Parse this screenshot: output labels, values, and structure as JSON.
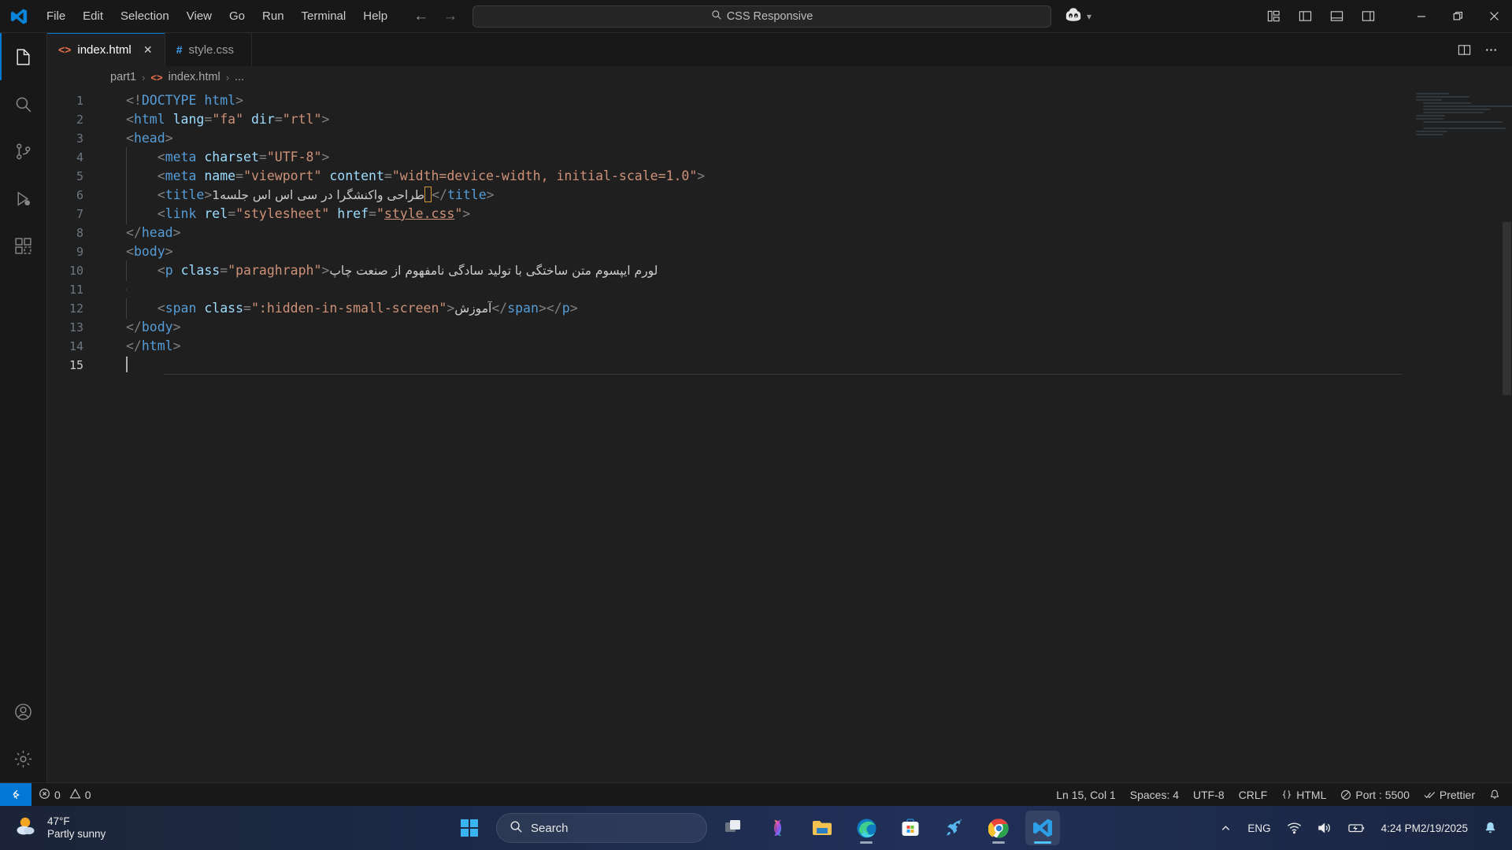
{
  "titlebar": {
    "logo_icon": "vscode-logo",
    "menus": [
      "File",
      "Edit",
      "Selection",
      "View",
      "Go",
      "Run",
      "Terminal",
      "Help"
    ],
    "back_icon": "arrow-left-icon",
    "forward_icon": "arrow-right-icon",
    "search_icon": "search-icon",
    "search_value": "CSS Responsive",
    "copilot_icon": "copilot-icon",
    "copilot_chevron_icon": "chevron-down-icon",
    "layout_buttons": [
      {
        "name": "customize-layout",
        "icon": "layout-customize-icon"
      },
      {
        "name": "toggle-primary-sidebar",
        "icon": "layout-sidebar-left-icon"
      },
      {
        "name": "toggle-panel",
        "icon": "layout-panel-icon"
      },
      {
        "name": "toggle-secondary-sidebar",
        "icon": "layout-sidebar-right-icon"
      }
    ],
    "window_buttons": [
      {
        "name": "minimize",
        "glyph": "—"
      },
      {
        "name": "maximize",
        "glyph": "❐"
      },
      {
        "name": "close",
        "glyph": "✕"
      }
    ]
  },
  "activitybar": {
    "items": [
      {
        "name": "explorer",
        "icon": "files-icon",
        "active": true
      },
      {
        "name": "search",
        "icon": "search-icon",
        "active": false
      },
      {
        "name": "source-control",
        "icon": "source-control-icon",
        "active": false
      },
      {
        "name": "run-and-debug",
        "icon": "debug-icon",
        "active": false
      },
      {
        "name": "extensions",
        "icon": "extensions-icon",
        "active": false
      }
    ],
    "bottom": [
      {
        "name": "accounts",
        "icon": "account-icon"
      },
      {
        "name": "manage",
        "icon": "gear-icon"
      }
    ]
  },
  "tabs": [
    {
      "label": "index.html",
      "icon": "html-file-icon",
      "active": true,
      "close_glyph": "✕"
    },
    {
      "label": "style.css",
      "icon": "css-file-icon",
      "active": false,
      "close_glyph": ""
    }
  ],
  "tabs_actions": [
    {
      "name": "split-editor",
      "icon": "split-editor-icon"
    },
    {
      "name": "more-actions",
      "icon": "ellipsis-icon"
    }
  ],
  "breadcrumb": {
    "folder": "part1",
    "sep": "›",
    "file_icon": "html-file-icon",
    "file": "index.html",
    "tail": "..."
  },
  "editor": {
    "language": "html",
    "cursor_line": 15,
    "lines": [
      {
        "n": 1,
        "indent": false,
        "segments": [
          {
            "c": "pnc",
            "t": "<!"
          },
          {
            "c": "doct",
            "t": "DOCTYPE"
          },
          {
            "c": "txt",
            "t": " "
          },
          {
            "c": "tag",
            "t": "html"
          },
          {
            "c": "pnc",
            "t": ">"
          }
        ]
      },
      {
        "n": 2,
        "indent": false,
        "segments": [
          {
            "c": "pnc",
            "t": "<"
          },
          {
            "c": "tag",
            "t": "html"
          },
          {
            "c": "txt",
            "t": " "
          },
          {
            "c": "attr",
            "t": "lang"
          },
          {
            "c": "pnc",
            "t": "="
          },
          {
            "c": "str",
            "t": "\"fa\""
          },
          {
            "c": "txt",
            "t": " "
          },
          {
            "c": "attr",
            "t": "dir"
          },
          {
            "c": "pnc",
            "t": "="
          },
          {
            "c": "str",
            "t": "\"rtl\""
          },
          {
            "c": "pnc",
            "t": ">"
          }
        ]
      },
      {
        "n": 3,
        "indent": false,
        "segments": [
          {
            "c": "pnc",
            "t": "<"
          },
          {
            "c": "tag",
            "t": "head"
          },
          {
            "c": "pnc",
            "t": ">"
          }
        ]
      },
      {
        "n": 4,
        "indent": true,
        "segments": [
          {
            "c": "txt",
            "t": "    "
          },
          {
            "c": "pnc",
            "t": "<"
          },
          {
            "c": "tag",
            "t": "meta"
          },
          {
            "c": "txt",
            "t": " "
          },
          {
            "c": "attr",
            "t": "charset"
          },
          {
            "c": "pnc",
            "t": "="
          },
          {
            "c": "str",
            "t": "\"UTF-8\""
          },
          {
            "c": "pnc",
            "t": ">"
          }
        ]
      },
      {
        "n": 5,
        "indent": true,
        "segments": [
          {
            "c": "txt",
            "t": "    "
          },
          {
            "c": "pnc",
            "t": "<"
          },
          {
            "c": "tag",
            "t": "meta"
          },
          {
            "c": "txt",
            "t": " "
          },
          {
            "c": "attr",
            "t": "name"
          },
          {
            "c": "pnc",
            "t": "="
          },
          {
            "c": "str",
            "t": "\"viewport\""
          },
          {
            "c": "txt",
            "t": " "
          },
          {
            "c": "attr",
            "t": "content"
          },
          {
            "c": "pnc",
            "t": "="
          },
          {
            "c": "str",
            "t": "\"width=device-width, initial-scale=1.0\""
          },
          {
            "c": "pnc",
            "t": ">"
          }
        ]
      },
      {
        "n": 6,
        "indent": true,
        "segments": [
          {
            "c": "txt",
            "t": "    "
          },
          {
            "c": "pnc",
            "t": "<"
          },
          {
            "c": "tag",
            "t": "title"
          },
          {
            "c": "pnc",
            "t": ">"
          },
          {
            "c": "rtltxt",
            "t": "طراحی واکنشگرا در سی اس اس جلسه1"
          },
          {
            "c": "cursorbox",
            "t": ""
          },
          {
            "c": "pnc",
            "t": "</"
          },
          {
            "c": "tag",
            "t": "title"
          },
          {
            "c": "pnc",
            "t": ">"
          }
        ]
      },
      {
        "n": 7,
        "indent": true,
        "segments": [
          {
            "c": "txt",
            "t": "    "
          },
          {
            "c": "pnc",
            "t": "<"
          },
          {
            "c": "tag",
            "t": "link"
          },
          {
            "c": "txt",
            "t": " "
          },
          {
            "c": "attr",
            "t": "rel"
          },
          {
            "c": "pnc",
            "t": "="
          },
          {
            "c": "str",
            "t": "\"stylesheet\""
          },
          {
            "c": "txt",
            "t": " "
          },
          {
            "c": "attr",
            "t": "href"
          },
          {
            "c": "pnc",
            "t": "="
          },
          {
            "c": "str",
            "t": "\""
          },
          {
            "c": "link",
            "t": "style.css"
          },
          {
            "c": "str",
            "t": "\""
          },
          {
            "c": "pnc",
            "t": ">"
          }
        ]
      },
      {
        "n": 8,
        "indent": false,
        "segments": [
          {
            "c": "pnc",
            "t": "</"
          },
          {
            "c": "tag",
            "t": "head"
          },
          {
            "c": "pnc",
            "t": ">"
          }
        ]
      },
      {
        "n": 9,
        "indent": false,
        "segments": [
          {
            "c": "pnc",
            "t": "<"
          },
          {
            "c": "tag",
            "t": "body"
          },
          {
            "c": "pnc",
            "t": ">"
          }
        ]
      },
      {
        "n": 10,
        "indent": true,
        "segments": [
          {
            "c": "txt",
            "t": "    "
          },
          {
            "c": "pnc",
            "t": "<"
          },
          {
            "c": "tag",
            "t": "p"
          },
          {
            "c": "txt",
            "t": " "
          },
          {
            "c": "attr",
            "t": "class"
          },
          {
            "c": "pnc",
            "t": "="
          },
          {
            "c": "str",
            "t": "\"paraghraph\""
          },
          {
            "c": "pnc",
            "t": ">"
          },
          {
            "c": "rtltxt",
            "t": "لورم ایپسوم متن ساختگی با تولید سادگی نامفهوم از صنعت چاپ"
          }
        ]
      },
      {
        "n": 11,
        "indent": true,
        "segments": []
      },
      {
        "n": 12,
        "indent": true,
        "segments": [
          {
            "c": "txt",
            "t": "    "
          },
          {
            "c": "pnc",
            "t": "<"
          },
          {
            "c": "tag",
            "t": "span"
          },
          {
            "c": "txt",
            "t": " "
          },
          {
            "c": "attr",
            "t": "class"
          },
          {
            "c": "pnc",
            "t": "="
          },
          {
            "c": "str",
            "t": "\":hidden-in-small-screen\""
          },
          {
            "c": "pnc",
            "t": ">"
          },
          {
            "c": "rtltxt",
            "t": "آموزش"
          },
          {
            "c": "pnc",
            "t": "</"
          },
          {
            "c": "tag",
            "t": "span"
          },
          {
            "c": "pnc",
            "t": ">"
          },
          {
            "c": "pnc",
            "t": "</"
          },
          {
            "c": "tag",
            "t": "p"
          },
          {
            "c": "pnc",
            "t": ">"
          }
        ]
      },
      {
        "n": 13,
        "indent": false,
        "segments": [
          {
            "c": "pnc",
            "t": "</"
          },
          {
            "c": "tag",
            "t": "body"
          },
          {
            "c": "pnc",
            "t": ">"
          }
        ]
      },
      {
        "n": 14,
        "indent": false,
        "segments": [
          {
            "c": "pnc",
            "t": "</"
          },
          {
            "c": "tag",
            "t": "html"
          },
          {
            "c": "pnc",
            "t": ">"
          }
        ]
      },
      {
        "n": 15,
        "indent": false,
        "segments": []
      }
    ]
  },
  "statusbar": {
    "remote_icon": "remote-window-icon",
    "errors_icon": "error-icon",
    "errors": "0",
    "warnings_icon": "warning-icon",
    "warnings": "0",
    "right": [
      {
        "name": "editor-position",
        "label": "Ln 15, Col 1"
      },
      {
        "name": "indentation",
        "label": "Spaces: 4"
      },
      {
        "name": "encoding",
        "label": "UTF-8"
      },
      {
        "name": "eol",
        "label": "CRLF"
      },
      {
        "name": "language-mode",
        "label": "HTML",
        "icon": "braces-icon"
      },
      {
        "name": "live-server-port",
        "label": "Port : 5500",
        "icon": "circle-slash-icon"
      },
      {
        "name": "prettier",
        "label": "Prettier",
        "icon": "check-all-icon"
      },
      {
        "name": "notifications",
        "label": "",
        "icon": "bell-icon"
      }
    ]
  },
  "taskbar": {
    "weather": {
      "icon": "partly-sunny-icon",
      "temp": "47°F",
      "condition": "Partly sunny"
    },
    "start_icon": "windows-start-icon",
    "search": {
      "icon": "search-icon",
      "placeholder": "Search"
    },
    "apps": [
      {
        "name": "task-view",
        "icon": "task-view-icon",
        "state": "idle"
      },
      {
        "name": "copilot",
        "icon": "copilot-taskbar-icon",
        "state": "idle"
      },
      {
        "name": "file-explorer",
        "icon": "folder-icon",
        "state": "idle"
      },
      {
        "name": "microsoft-edge",
        "icon": "edge-icon",
        "state": "running"
      },
      {
        "name": "microsoft-store",
        "icon": "store-icon",
        "state": "idle"
      },
      {
        "name": "rocket-app",
        "icon": "rocket-icon",
        "state": "idle"
      },
      {
        "name": "google-chrome",
        "icon": "chrome-icon",
        "state": "running"
      },
      {
        "name": "visual-studio-code",
        "icon": "vscode-icon",
        "state": "active"
      }
    ],
    "tray": {
      "overflow_icon": "chevron-up-icon",
      "language": "ENG",
      "wifi_icon": "wifi-icon",
      "volume_icon": "volume-icon",
      "battery_icon": "battery-charging-icon",
      "time": "4:24 PM",
      "date": "2/19/2025",
      "notification_icon": "bell-icon"
    }
  },
  "colors": {
    "accent": "#0078d4",
    "tag": "#569cd6",
    "attr": "#9cdcfe",
    "string": "#ce9178",
    "cursor_box": "#cd9731"
  }
}
